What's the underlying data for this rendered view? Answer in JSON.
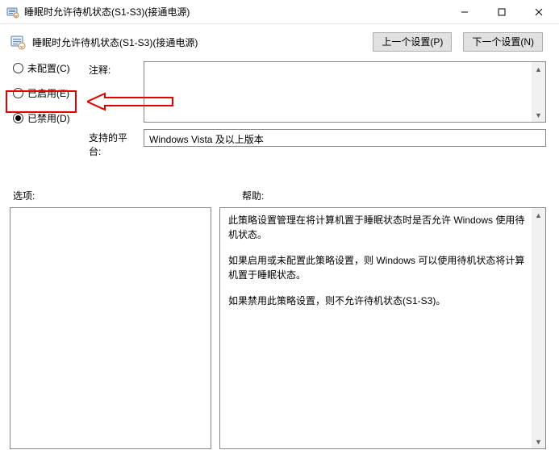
{
  "titlebar": {
    "title": "睡眠时允许待机状态(S1-S3)(接通电源)"
  },
  "header": {
    "setting_title": "睡眠时允许待机状态(S1-S3)(接通电源)",
    "prev_btn": "上一个设置(P)",
    "next_btn": "下一个设置(N)"
  },
  "radios": {
    "not_configured": "未配置(C)",
    "enabled": "已启用(E)",
    "disabled": "已禁用(D)"
  },
  "field_labels": {
    "note": "注释:",
    "platform": "支持的平台:"
  },
  "platform_value": "Windows Vista 及以上版本",
  "section_labels": {
    "options": "选项:",
    "help": "帮助:"
  },
  "help": {
    "p1": "此策略设置管理在将计算机置于睡眠状态时是否允许 Windows 使用待机状态。",
    "p2": "如果启用或未配置此策略设置，则 Windows 可以使用待机状态将计算机置于睡眠状态。",
    "p3": "如果禁用此策略设置，则不允许待机状态(S1-S3)。"
  }
}
